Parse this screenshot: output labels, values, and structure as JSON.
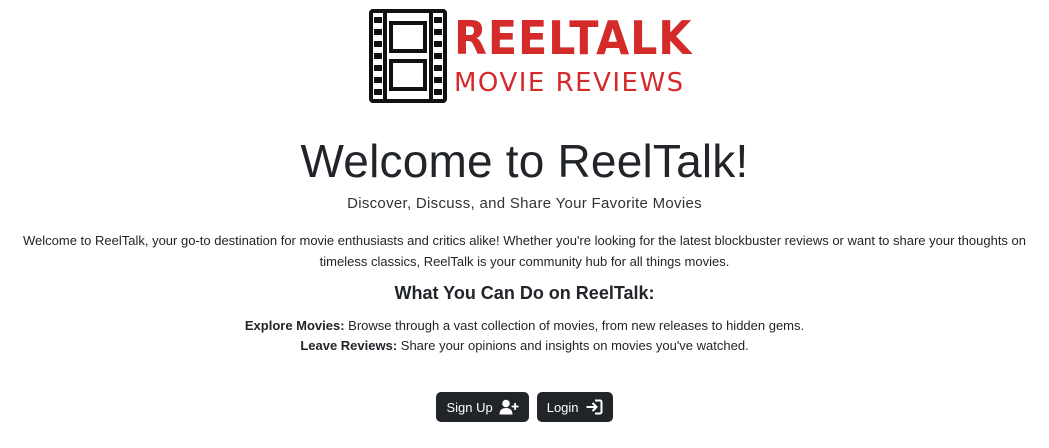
{
  "logo": {
    "title": "REELTALK",
    "subtitle": "MOVIE REVIEWS",
    "color": "#d42a2a",
    "icon": "film-strip-icon"
  },
  "hero": {
    "title": "Welcome to ReelTalk!",
    "subtitle": "Discover, Discuss, and Share Your Favorite Movies",
    "intro": "Welcome to ReelTalk, your go-to destination for movie enthusiasts and critics alike! Whether you're looking for the latest blockbuster reviews or want to share your thoughts on timeless classics, ReelTalk is your community hub for all things movies."
  },
  "features": {
    "heading": "What You Can Do on ReelTalk:",
    "items": [
      {
        "label": "Explore Movies:",
        "text": " Browse through a vast collection of movies, from new releases to hidden gems."
      },
      {
        "label": "Leave Reviews:",
        "text": " Share your opinions and insights on movies you've watched."
      }
    ]
  },
  "actions": {
    "signup_label": "Sign Up",
    "signup_icon": "user-plus-icon",
    "login_label": "Login",
    "login_icon": "sign-in-icon",
    "button_color": "#212529"
  }
}
